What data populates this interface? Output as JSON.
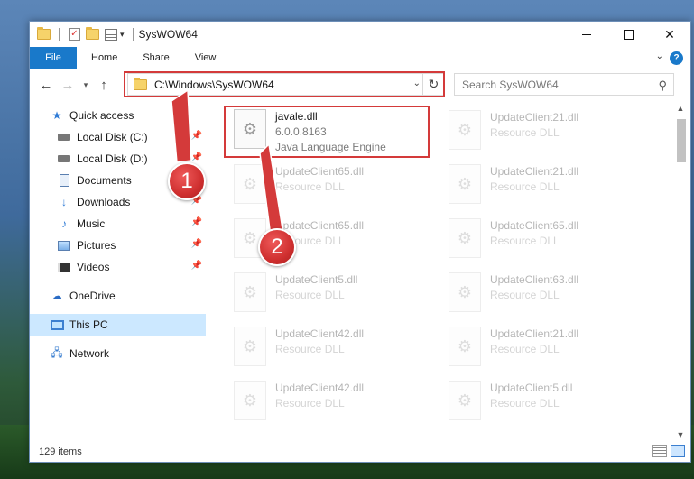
{
  "window": {
    "title": "SysWOW64"
  },
  "ribbon": {
    "tabs": [
      "File",
      "Home",
      "Share",
      "View"
    ],
    "help_label": "?"
  },
  "navbar": {
    "address": "C:\\Windows\\SysWOW64",
    "search_placeholder": "Search SysWOW64"
  },
  "sidebar": {
    "quick_access": "Quick access",
    "items": [
      {
        "label": "Local Disk (C:)",
        "icon": "drive-icon",
        "pinned": true
      },
      {
        "label": "Local Disk (D:)",
        "icon": "drive-icon",
        "pinned": true
      },
      {
        "label": "Documents",
        "icon": "documents-icon",
        "pinned": true
      },
      {
        "label": "Downloads",
        "icon": "download-icon",
        "pinned": true
      },
      {
        "label": "Music",
        "icon": "music-icon",
        "pinned": true
      },
      {
        "label": "Pictures",
        "icon": "pictures-icon",
        "pinned": true
      },
      {
        "label": "Videos",
        "icon": "videos-icon",
        "pinned": true
      }
    ],
    "onedrive": "OneDrive",
    "this_pc": "This PC",
    "network": "Network"
  },
  "files": {
    "highlighted": {
      "name": "javale.dll",
      "version": "6.0.0.8163",
      "description": "Java Language Engine"
    },
    "left_column": [
      {
        "name": "UpdateClient65.dll",
        "type": "Resource DLL"
      },
      {
        "name": "UpdateClient65.dll",
        "type": "Resource DLL"
      },
      {
        "name": "UpdateClient5.dll",
        "type": "Resource DLL"
      },
      {
        "name": "UpdateClient42.dll",
        "type": "Resource DLL"
      },
      {
        "name": "UpdateClient42.dll",
        "type": "Resource DLL"
      }
    ],
    "right_column": [
      {
        "name": "UpdateClient21.dll",
        "type": "Resource DLL"
      },
      {
        "name": "UpdateClient21.dll",
        "type": "Resource DLL"
      },
      {
        "name": "UpdateClient65.dll",
        "type": "Resource DLL"
      },
      {
        "name": "UpdateClient63.dll",
        "type": "Resource DLL"
      },
      {
        "name": "UpdateClient21.dll",
        "type": "Resource DLL"
      },
      {
        "name": "UpdateClient5.dll",
        "type": "Resource DLL"
      }
    ]
  },
  "status": {
    "item_count": "129 items"
  },
  "annotations": {
    "step1": "1",
    "step2": "2",
    "color": "#d43a3a"
  }
}
